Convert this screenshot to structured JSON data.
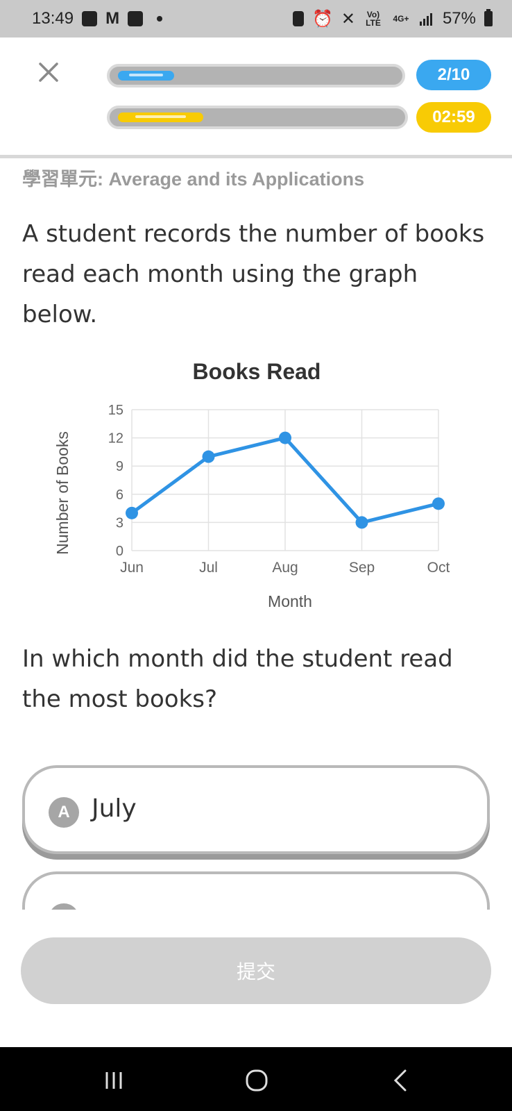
{
  "status_bar": {
    "time": "13:49",
    "left_icons": [
      "gallery-icon",
      "gmail-icon",
      "check-icon",
      "notification-dot"
    ],
    "right_icons": [
      "battery-saver-icon",
      "alarm-icon",
      "mute-icon",
      "volte-icon",
      "4g-icon",
      "signal-icon"
    ],
    "volte": "Vo) LTE",
    "network": "4G+",
    "battery": "57%"
  },
  "header": {
    "progress_label": "2/10",
    "progress_fraction": 0.2,
    "timer_label": "02:59",
    "timer_fraction": 0.3,
    "colors": {
      "progress": "#3aa8f0",
      "progress_pill": "#3aa8f0",
      "timer": "#f8cb05",
      "timer_pill": "#f8cb05"
    }
  },
  "unit": {
    "title": "學習單元: Average and its Applications"
  },
  "question": {
    "intro": "A student records the number of books read each month using the graph below.",
    "prompt": "In which month did the student read the most books?"
  },
  "chart_data": {
    "type": "line",
    "title": "Books Read",
    "xlabel": "Month",
    "ylabel": "Number of Books",
    "categories": [
      "Jun",
      "Jul",
      "Aug",
      "Sep",
      "Oct"
    ],
    "series": [
      {
        "values": [
          4,
          10,
          12,
          3,
          5
        ],
        "color": "#2f93e4"
      }
    ],
    "ylim": [
      0,
      15
    ],
    "yticks": [
      "0",
      "3",
      "6",
      "9",
      "12",
      "15"
    ],
    "grid": true
  },
  "options": [
    {
      "letter": "A",
      "text": "July"
    }
  ],
  "submit": {
    "label": "提交"
  },
  "nav_bar": {
    "icons": [
      "recent-apps-icon",
      "home-icon",
      "back-icon"
    ]
  }
}
